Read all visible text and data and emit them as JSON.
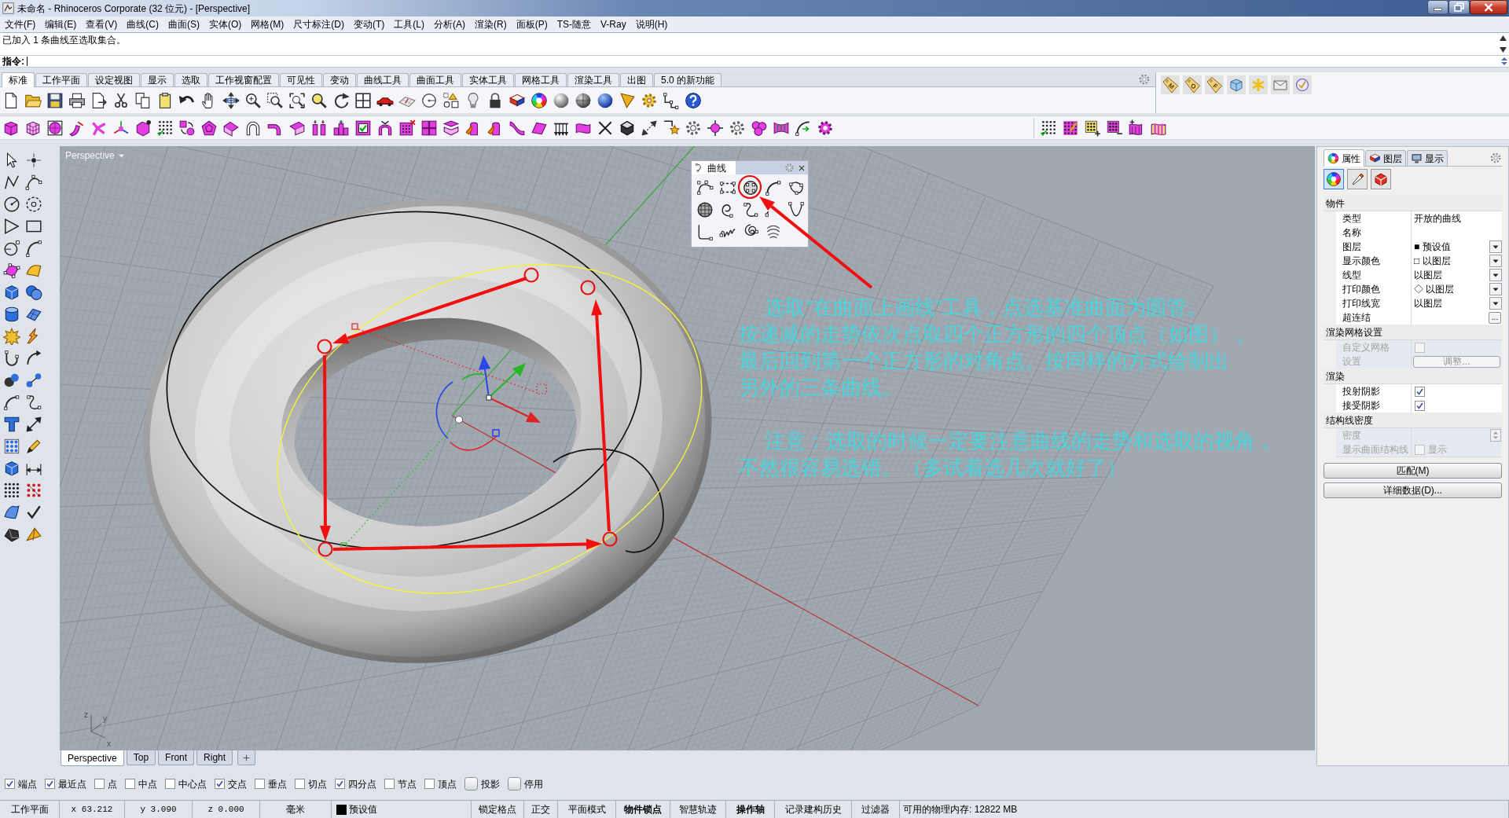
{
  "window": {
    "title": "未命名 - Rhinoceros Corporate (32 位元) - [Perspective]"
  },
  "menu": [
    "文件(F)",
    "编辑(E)",
    "查看(V)",
    "曲线(C)",
    "曲面(S)",
    "实体(O)",
    "网格(M)",
    "尺寸标注(D)",
    "变动(T)",
    "工具(L)",
    "分析(A)",
    "渲染(R)",
    "面板(P)",
    "TS-随意",
    "V-Ray",
    "说明(H)"
  ],
  "command": {
    "history": "已加入 1 条曲线至选取集合。",
    "prompt": "指令:"
  },
  "toolbar_tabs": [
    {
      "label": "标准",
      "selected": true
    },
    {
      "label": "工作平面",
      "selected": false
    },
    {
      "label": "设定视图",
      "selected": false
    },
    {
      "label": "显示",
      "selected": false
    },
    {
      "label": "选取",
      "selected": false
    },
    {
      "label": "工作视窗配置",
      "selected": false
    },
    {
      "label": "可见性",
      "selected": false
    },
    {
      "label": "变动",
      "selected": false
    },
    {
      "label": "曲线工具",
      "selected": false
    },
    {
      "label": "曲面工具",
      "selected": false
    },
    {
      "label": "实体工具",
      "selected": false
    },
    {
      "label": "网格工具",
      "selected": false
    },
    {
      "label": "渲染工具",
      "selected": false
    },
    {
      "label": "出图",
      "selected": false
    },
    {
      "label": "5.0 的新功能",
      "selected": false
    }
  ],
  "tag_toolbar": {
    "tags": [
      "M",
      "O",
      "F"
    ]
  },
  "viewport": {
    "title": "Perspective",
    "floating_toolbar": {
      "title": "曲线"
    },
    "annotation": {
      "paragraphs": [
        {
          "lines": [
            "选取“在曲面上画线”工具，点选基准曲面为圆管。",
            "按递减的走势依次点取四个正方形的四个顶点（如图），",
            "最后回到第一个正方形的对角点。按同样的方式绘制出",
            "另外的三条曲线。"
          ]
        },
        {
          "lines": [
            "注意：选取的时候一定要注意曲线的走势和选取的视角，",
            "不然很容易选错。（多试着选几次就好了）"
          ]
        }
      ]
    },
    "axes_labels": [
      "z",
      "y",
      "x"
    ]
  },
  "properties_panel": {
    "tabs": [
      {
        "label": "属性",
        "selected": true
      },
      {
        "label": "图层",
        "selected": false
      },
      {
        "label": "显示",
        "selected": false
      }
    ],
    "pages": [
      {
        "selected": true
      },
      {
        "selected": false
      },
      {
        "selected": false
      }
    ],
    "sections": [
      {
        "title": "物件",
        "rows": [
          {
            "kind": "text",
            "label": "类型",
            "value": "开放的曲线",
            "disabled": false
          },
          {
            "kind": "field",
            "label": "名称",
            "disabled": false
          },
          {
            "kind": "dropdown",
            "label": "图层",
            "value": "■ 预设值",
            "disabled": false
          },
          {
            "kind": "dropdown",
            "label": "显示颜色",
            "value": "□ 以图层",
            "disabled": false
          },
          {
            "kind": "dropdown",
            "label": "线型",
            "value": "以图层",
            "disabled": false
          },
          {
            "kind": "dropdown",
            "label": "打印颜色",
            "value": "◇ 以图层",
            "disabled": false
          },
          {
            "kind": "dropdown",
            "label": "打印线宽",
            "value": "以图层",
            "disabled": false
          },
          {
            "kind": "browse",
            "label": "超连结",
            "button": "...",
            "disabled": false
          }
        ]
      },
      {
        "title": "渲染网格设置",
        "rows": [
          {
            "kind": "checkbox",
            "label": "自定义网格",
            "checked": false,
            "disabled": true
          },
          {
            "kind": "button",
            "label": "设置",
            "button": "调整...",
            "disabled": true
          }
        ]
      },
      {
        "title": "渲染",
        "rows": [
          {
            "kind": "checkbox",
            "label": "投射阴影",
            "checked": true,
            "disabled": false
          },
          {
            "kind": "checkbox",
            "label": "接受阴影",
            "checked": true,
            "disabled": false
          }
        ]
      },
      {
        "title": "结构线密度",
        "rows": [
          {
            "kind": "spinner",
            "label": "密度",
            "disabled": true
          },
          {
            "kind": "checkbox",
            "label": "显示曲面结构线",
            "checked": false,
            "disabled": true,
            "text": "显示"
          }
        ]
      }
    ],
    "buttons": [
      "匹配(M)",
      "详细数据(D)..."
    ]
  },
  "viewport_tabs": [
    {
      "label": "Perspective",
      "selected": true
    },
    {
      "label": "Top",
      "selected": false
    },
    {
      "label": "Front",
      "selected": false
    },
    {
      "label": "Right",
      "selected": false
    }
  ],
  "osnaps": [
    {
      "kind": "checkbox",
      "label": "端点",
      "checked": true
    },
    {
      "kind": "checkbox",
      "label": "最近点",
      "checked": true
    },
    {
      "kind": "checkbox",
      "label": "点",
      "checked": false
    },
    {
      "kind": "checkbox",
      "label": "中点",
      "checked": false
    },
    {
      "kind": "checkbox",
      "label": "中心点",
      "checked": false
    },
    {
      "kind": "checkbox",
      "label": "交点",
      "checked": true
    },
    {
      "kind": "checkbox",
      "label": "垂点",
      "checked": false
    },
    {
      "kind": "checkbox",
      "label": "切点",
      "checked": false
    },
    {
      "kind": "checkbox",
      "label": "四分点",
      "checked": true
    },
    {
      "kind": "checkbox",
      "label": "节点",
      "checked": false
    },
    {
      "kind": "checkbox",
      "label": "顶点",
      "checked": false
    },
    {
      "kind": "toggle",
      "label": "投影",
      "checked": false
    },
    {
      "kind": "toggle",
      "label": "停用",
      "checked": false
    }
  ],
  "status_bar": [
    {
      "kind": "label",
      "text": "工作平面",
      "on": false
    },
    {
      "kind": "coordinate",
      "text": "x 63.212",
      "on": false
    },
    {
      "kind": "coordinate",
      "text": "y 3.090",
      "on": false
    },
    {
      "kind": "coordinate",
      "text": "z 0.000",
      "on": false
    },
    {
      "kind": "label",
      "text": "毫米",
      "on": false
    },
    {
      "kind": "layer",
      "text": "预设值",
      "on": false
    },
    {
      "kind": "toggle",
      "text": "锁定格点",
      "on": false
    },
    {
      "kind": "toggle",
      "text": "正交",
      "on": false
    },
    {
      "kind": "toggle",
      "text": "平面模式",
      "on": false
    },
    {
      "kind": "toggle",
      "text": "物件锁点",
      "on": true
    },
    {
      "kind": "toggle",
      "text": "智慧轨迹",
      "on": false
    },
    {
      "kind": "toggle",
      "text": "操作轴",
      "on": true
    },
    {
      "kind": "toggle",
      "text": "记录建构历史",
      "on": false
    },
    {
      "kind": "toggle",
      "text": "过滤器",
      "on": false
    },
    {
      "kind": "label",
      "text": "可用的物理内存: 12822 MB",
      "on": false
    }
  ]
}
